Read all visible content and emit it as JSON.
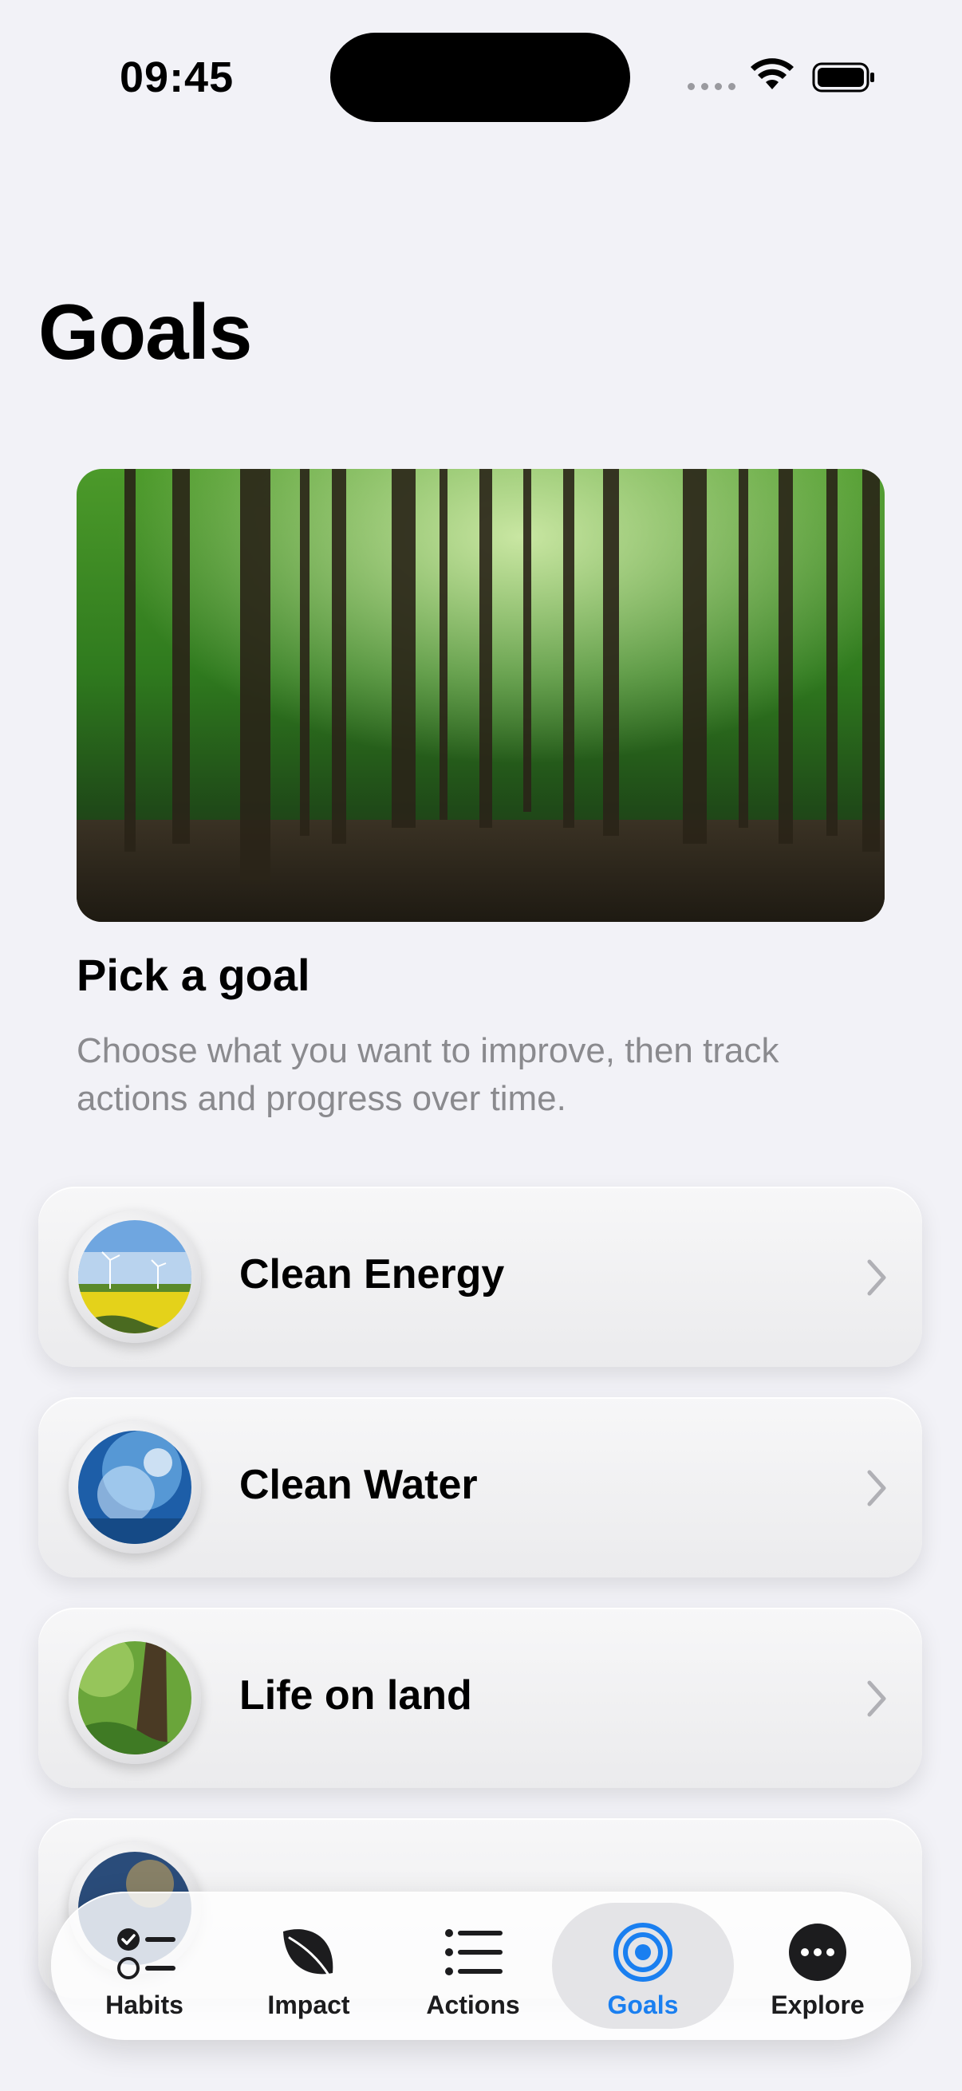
{
  "status": {
    "time": "09:45"
  },
  "page": {
    "title": "Goals"
  },
  "intro": {
    "title": "Pick a goal",
    "subtitle": "Choose what you want to improve, then track actions and progress over time."
  },
  "goals": [
    {
      "label": "Clean Energy",
      "icon": "wind-turbine-field-image"
    },
    {
      "label": "Clean Water",
      "icon": "water-splash-image"
    },
    {
      "label": "Life on land",
      "icon": "forest-moss-image"
    }
  ],
  "tabs": [
    {
      "label": "Habits",
      "icon": "checklist-icon"
    },
    {
      "label": "Impact",
      "icon": "leaf-icon"
    },
    {
      "label": "Actions",
      "icon": "list-icon"
    },
    {
      "label": "Goals",
      "icon": "target-icon",
      "active": true
    },
    {
      "label": "Explore",
      "icon": "more-icon"
    }
  ],
  "colors": {
    "accent": "#1a7ff0",
    "background": "#f2f2f7",
    "secondary_text": "#8a8a8e"
  }
}
